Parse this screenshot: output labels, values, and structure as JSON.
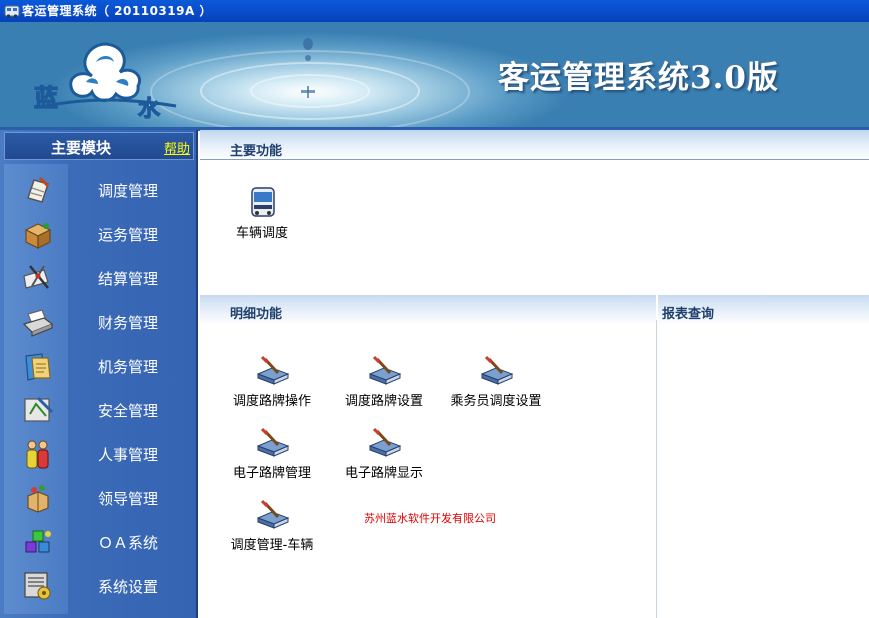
{
  "window": {
    "title": "客运管理系统（ 20110319A ）"
  },
  "banner": {
    "title": "客运管理系统3.0版",
    "logo_text": [
      "蓝",
      "水"
    ]
  },
  "sidebar": {
    "title": "主要模块",
    "help": "帮助",
    "items": [
      {
        "label": "调度管理",
        "icon": "dispatch-icon"
      },
      {
        "label": "运务管理",
        "icon": "box-icon"
      },
      {
        "label": "结算管理",
        "icon": "settlement-icon"
      },
      {
        "label": "财务管理",
        "icon": "printer-icon"
      },
      {
        "label": "机务管理",
        "icon": "folder-icon"
      },
      {
        "label": "安全管理",
        "icon": "safety-icon"
      },
      {
        "label": "人事管理",
        "icon": "people-icon"
      },
      {
        "label": "领导管理",
        "icon": "gift-box-icon"
      },
      {
        "label": "ＯＡ系统",
        "icon": "cubes-icon"
      },
      {
        "label": "系统设置",
        "icon": "settings-icon"
      }
    ]
  },
  "main": {
    "primary": {
      "title": "主要功能",
      "items": [
        {
          "label": "车辆调度",
          "icon": "bus-icon"
        }
      ]
    },
    "detail": {
      "title": "明细功能",
      "items": [
        {
          "label": "调度路牌操作",
          "icon": "signboard-icon"
        },
        {
          "label": "调度路牌设置",
          "icon": "signboard-icon"
        },
        {
          "label": "乘务员调度设置",
          "icon": "signboard-icon"
        },
        {
          "label": "电子路牌管理",
          "icon": "signboard-icon"
        },
        {
          "label": "电子路牌显示",
          "icon": "signboard-icon"
        },
        {
          "label": "调度管理-车辆",
          "icon": "signboard-icon"
        }
      ]
    },
    "report": {
      "title": "报表查询"
    },
    "company": "苏州蓝水软件开发有限公司"
  },
  "colors": {
    "titlebar": "#0a4fd0",
    "sidebar": "#3c6cb8",
    "help_link": "#ffff00",
    "company_text": "#e00000",
    "section_title": "#1f3f6e"
  }
}
